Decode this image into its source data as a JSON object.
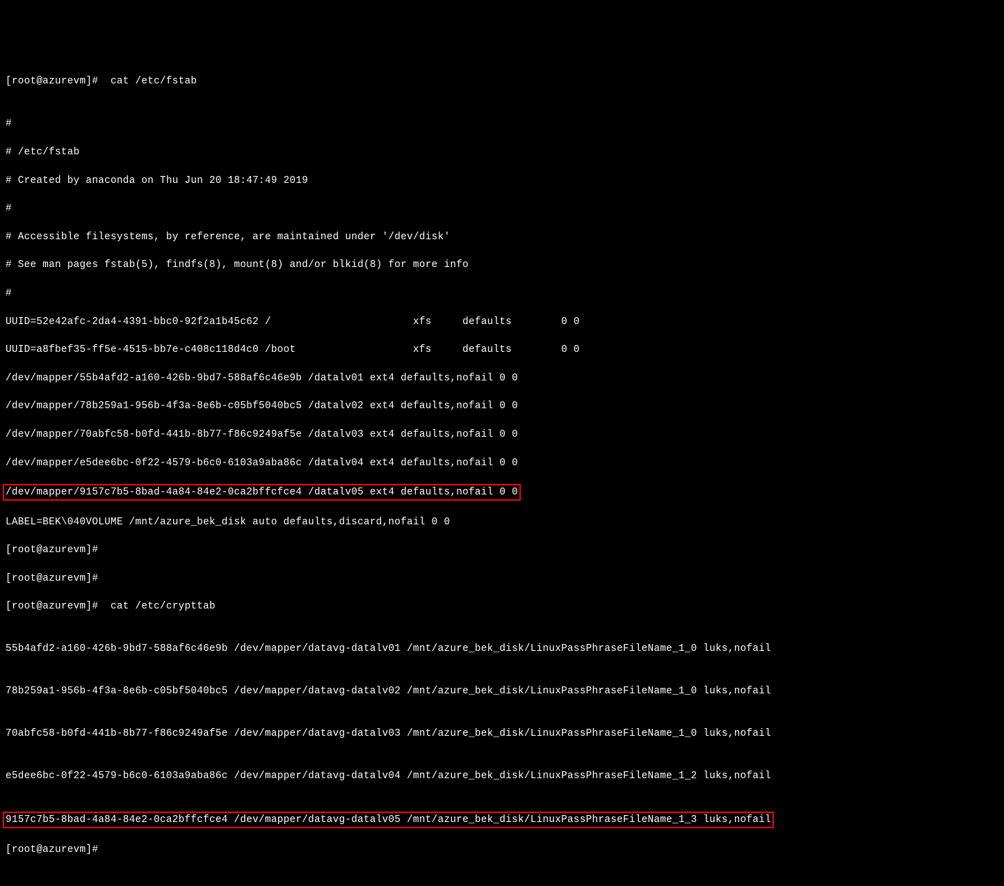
{
  "lines": {
    "l0": "[root@azurevm]#  cat /etc/fstab",
    "l1": "",
    "l2": "#",
    "l3": "# /etc/fstab",
    "l4": "# Created by anaconda on Thu Jun 20 18:47:49 2019",
    "l5": "#",
    "l6": "# Accessible filesystems, by reference, are maintained under '/dev/disk'",
    "l7": "# See man pages fstab(5), findfs(8), mount(8) and/or blkid(8) for more info",
    "l8": "#",
    "l9": "UUID=52e42afc-2da4-4391-bbc0-92f2a1b45c62 /                       xfs     defaults        0 0",
    "l10": "UUID=a8fbef35-ff5e-4515-bb7e-c408c118d4c0 /boot                   xfs     defaults        0 0",
    "l11": "/dev/mapper/55b4afd2-a160-426b-9bd7-588af6c46e9b /datalv01 ext4 defaults,nofail 0 0",
    "l12": "/dev/mapper/78b259a1-956b-4f3a-8e6b-c05bf5040bc5 /datalv02 ext4 defaults,nofail 0 0",
    "l13": "/dev/mapper/70abfc58-b0fd-441b-8b77-f86c9249af5e /datalv03 ext4 defaults,nofail 0 0",
    "l14": "/dev/mapper/e5dee6bc-0f22-4579-b6c0-6103a9aba86c /datalv04 ext4 defaults,nofail 0 0",
    "l15": "/dev/mapper/9157c7b5-8bad-4a84-84e2-0ca2bffcfce4 /datalv05 ext4 defaults,nofail 0 0",
    "l16": "LABEL=BEK\\040VOLUME /mnt/azure_bek_disk auto defaults,discard,nofail 0 0",
    "l17": "[root@azurevm]#",
    "l18": "[root@azurevm]#",
    "l19": "[root@azurevm]#  cat /etc/crypttab",
    "l20": "",
    "l21": "55b4afd2-a160-426b-9bd7-588af6c46e9b /dev/mapper/datavg-datalv01 /mnt/azure_bek_disk/LinuxPassPhraseFileName_1_0 luks,nofail",
    "l22": "",
    "l23": "78b259a1-956b-4f3a-8e6b-c05bf5040bc5 /dev/mapper/datavg-datalv02 /mnt/azure_bek_disk/LinuxPassPhraseFileName_1_0 luks,nofail",
    "l24": "",
    "l25": "70abfc58-b0fd-441b-8b77-f86c9249af5e /dev/mapper/datavg-datalv03 /mnt/azure_bek_disk/LinuxPassPhraseFileName_1_0 luks,nofail",
    "l26": "",
    "l27": "e5dee6bc-0f22-4579-b6c0-6103a9aba86c /dev/mapper/datavg-datalv04 /mnt/azure_bek_disk/LinuxPassPhraseFileName_1_2 luks,nofail",
    "l28": "",
    "l29": "9157c7b5-8bad-4a84-84e2-0ca2bffcfce4 /dev/mapper/datavg-datalv05 /mnt/azure_bek_disk/LinuxPassPhraseFileName_1_3 luks,nofail",
    "l30": "[root@azurevm]#"
  }
}
